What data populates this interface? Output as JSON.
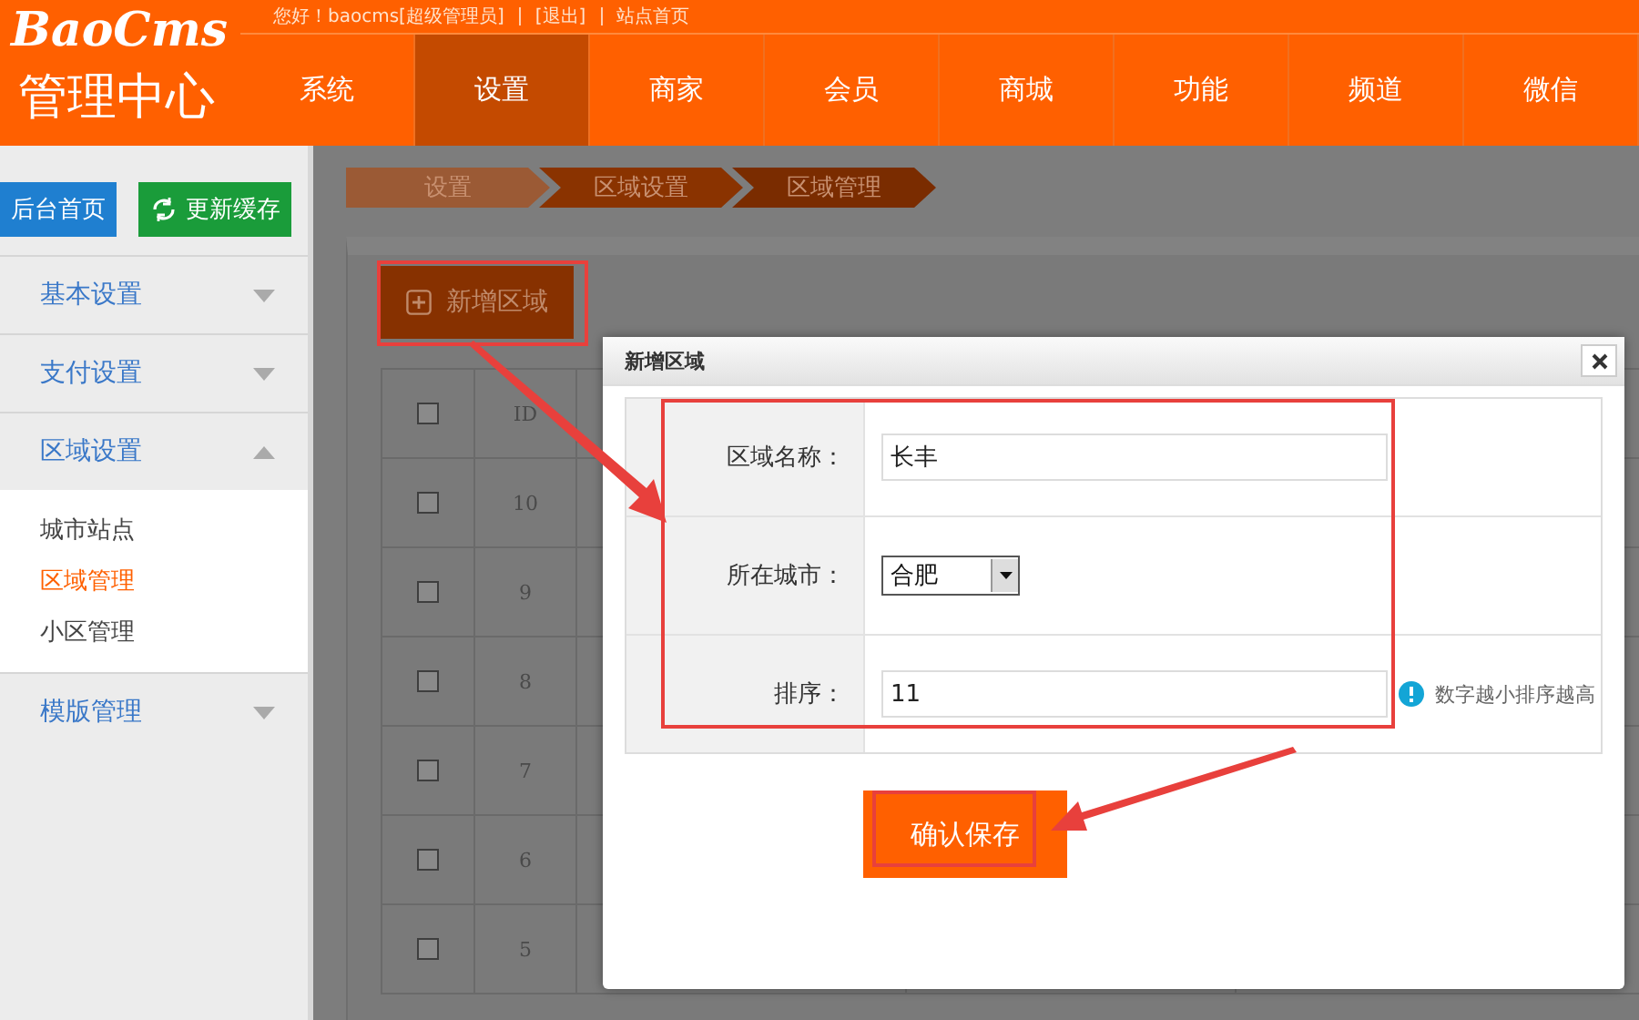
{
  "header": {
    "logo": "BaoCms",
    "subtitle": "管理中心",
    "top_links": [
      "您好！baocms[超级管理员]",
      "[退出]",
      "站点首页"
    ],
    "nav": [
      {
        "label": "系统",
        "selected": false
      },
      {
        "label": "设置",
        "selected": true
      },
      {
        "label": "商家",
        "selected": false
      },
      {
        "label": "会员",
        "selected": false
      },
      {
        "label": "商城",
        "selected": false
      },
      {
        "label": "功能",
        "selected": false
      },
      {
        "label": "频道",
        "selected": false
      },
      {
        "label": "微信",
        "selected": false
      }
    ]
  },
  "sidebar": {
    "buttons": [
      {
        "kind": "home",
        "label": "后台首页"
      },
      {
        "kind": "refresh",
        "label": "更新缓存"
      }
    ],
    "groups": [
      {
        "label": "基本设置",
        "expanded": false
      },
      {
        "label": "支付设置",
        "expanded": false
      },
      {
        "label": "区域设置",
        "expanded": true,
        "children": [
          {
            "label": "城市站点",
            "selected": false
          },
          {
            "label": "区域管理",
            "selected": true
          },
          {
            "label": "小区管理",
            "selected": false
          }
        ]
      },
      {
        "label": "模版管理",
        "expanded": false
      }
    ]
  },
  "breadcrumb": [
    "设置",
    "区域设置",
    "区域管理"
  ],
  "add_button": "新增区域",
  "table": {
    "header_checked": false,
    "header": "ID",
    "rows": [
      {
        "id": "10",
        "checked": false
      },
      {
        "id": "9",
        "checked": false
      },
      {
        "id": "8",
        "checked": false
      },
      {
        "id": "7",
        "checked": false
      },
      {
        "id": "6",
        "checked": false
      },
      {
        "id": "5",
        "checked": false
      }
    ]
  },
  "dialog": {
    "title": "新增区域",
    "fields": [
      {
        "kind": "text",
        "label": "区域名称：",
        "value": "长丰"
      },
      {
        "kind": "select",
        "label": "所在城市：",
        "value": "合肥"
      },
      {
        "kind": "text",
        "label": "排序：",
        "value": "11",
        "hint": "数字越小排序越高"
      }
    ],
    "submit": "确认保存"
  }
}
